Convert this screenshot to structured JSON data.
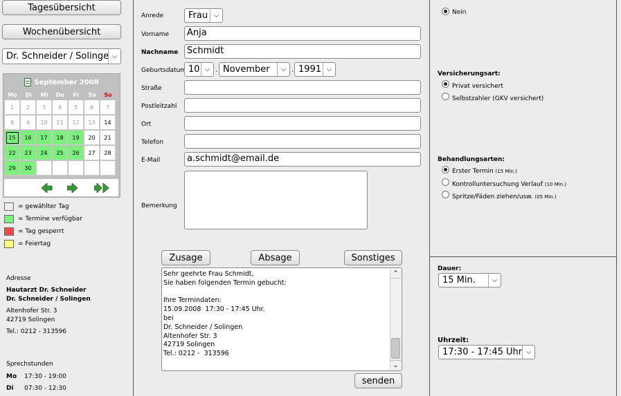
{
  "nav": {
    "day_view": "Tagesübersicht",
    "week_view": "Wochenübersicht",
    "doctor_select": "Dr. Schneider / Solingen"
  },
  "calendar": {
    "title": "September 2008",
    "weekdays": [
      "Mo",
      "Di",
      "Mi",
      "Do",
      "Fr",
      "Sa",
      "So"
    ],
    "weeks": [
      [
        "1",
        "2",
        "3",
        "4",
        "5",
        "6",
        "7"
      ],
      [
        "8",
        "9",
        "10",
        "11",
        "12",
        "13",
        "14"
      ],
      [
        "15",
        "16",
        "17",
        "18",
        "19",
        "20",
        "21"
      ],
      [
        "22",
        "23",
        "24",
        "25",
        "26",
        "27",
        "28"
      ],
      [
        "29",
        "30",
        "",
        "",
        "",
        "",
        ""
      ]
    ],
    "nav_icons": [
      "arrow-left-icon",
      "arrow-right-icon",
      "double-arrow-right-icon"
    ]
  },
  "legend": [
    {
      "label": "= gewählter Tag",
      "color": "#eeeeee"
    },
    {
      "label": "= Termine verfügbar",
      "color": "#7cf07c"
    },
    {
      "label": "= Tag gesperrt",
      "color": "#f04a4a"
    },
    {
      "label": "= Feiertag",
      "color": "#ffff80"
    }
  ],
  "address": {
    "heading": "Adresse",
    "name1": "Hautarzt Dr. Schneider",
    "name2": "Dr. Schneider / Solingen",
    "street": "Altenhofer Str. 3",
    "city": "42719 Solingen",
    "phone": "Tel.: 0212 - 313596"
  },
  "hours": {
    "heading": "Sprechstunden",
    "rows": [
      {
        "day": "Mo",
        "time": "17:30 - 19:00"
      },
      {
        "day": "Di",
        "time": "07:30 - 12:30"
      }
    ]
  },
  "form": {
    "salutation_label": "Anrede",
    "salutation_value": "Frau",
    "firstname_label": "Vorname",
    "firstname_value": "Anja",
    "lastname_label": "Nachname",
    "lastname_value": "Schmidt",
    "birthdate_label": "Geburtsdatum",
    "birth_day": "10",
    "birth_month": "November",
    "birth_year": "1991",
    "street_label": "Straße",
    "street_value": "",
    "zip_label": "Postleitzahl",
    "zip_value": "",
    "city_label": "Ort",
    "city_value": "",
    "phone_label": "Telefon",
    "phone_value": "",
    "email_label": "E-Mail",
    "email_value": "a.schmidt@email.de",
    "remark_label": "Bemerkung",
    "remark_value": ""
  },
  "actions": {
    "accept": "Zusage",
    "decline": "Absage",
    "other": "Sonstiges",
    "send": "senden"
  },
  "message_lines": [
    "Sehr geehrte Frau Schmidt,",
    "Sie haben folgenden Termin gebucht:",
    "",
    "Ihre Termindaten:",
    "15.09.2008  17:30 - 17:45 Uhr.",
    "bei",
    "Dr. Schneider / Solingen",
    "Altenhofer Str. 3",
    "42719 Solingen",
    "Tel.: 0212 -  313596"
  ],
  "right": {
    "top_option": "Nein",
    "insurance_heading": "Versicherungsart:",
    "insurance_options": [
      "Privat versichert",
      "Selbstzahler (GKV versichert)"
    ],
    "treatment_heading": "Behandlungsarten:",
    "treatments": [
      {
        "name": "Erster Termin",
        "dur": "(15 Min.)"
      },
      {
        "name": "Kontrolluntersuchung Verlauf",
        "dur": "(10 Min.)"
      },
      {
        "name": "Spritze/Fäden ziehen/usw.",
        "dur": "(05 Min.)"
      }
    ],
    "duration_heading": "Dauer:",
    "duration_value": "15 Min.",
    "time_heading": "Uhrzeit:",
    "time_value": "17:30 - 17:45 Uhr"
  }
}
